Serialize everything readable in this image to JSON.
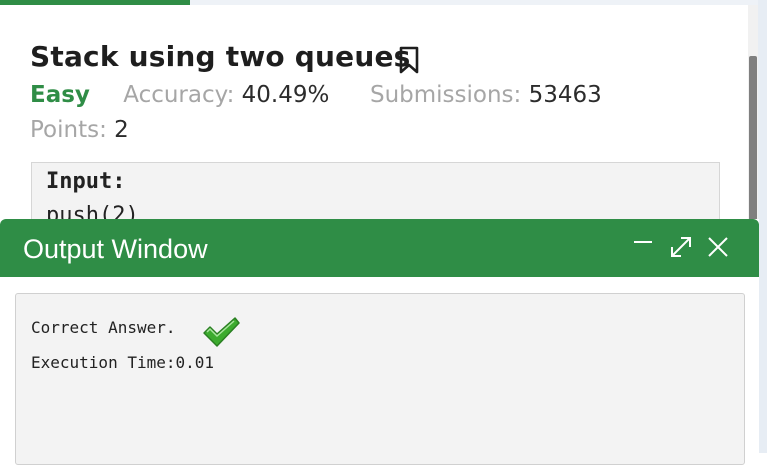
{
  "problem": {
    "title": "Stack using two queues",
    "difficulty": "Easy",
    "accuracy_label": "Accuracy:",
    "accuracy_value": "40.49%",
    "submissions_label": "Submissions:",
    "submissions_value": "53463",
    "points_label": "Points:",
    "points_value": "2"
  },
  "example": {
    "input_label": "Input:",
    "first_line": "push(2)"
  },
  "output_window": {
    "title": "Output Window",
    "result": "Correct Answer.",
    "execution_time": "Execution Time:0.01"
  },
  "colors": {
    "accent_green": "#2f8d46",
    "check_green": "#3cab2e"
  },
  "icons": [
    "bookmark-icon",
    "minimize-icon",
    "expand-icon",
    "close-icon",
    "checkmark-icon"
  ]
}
